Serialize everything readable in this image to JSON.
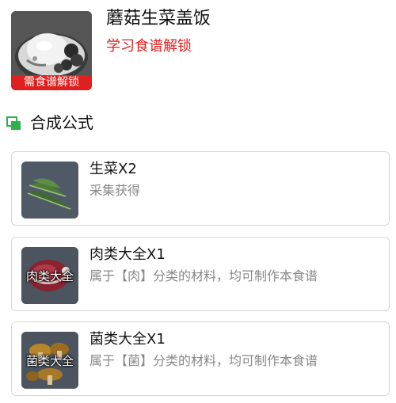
{
  "recipe": {
    "title": "蘑菇生菜盖饭",
    "unlock_hint": "学习食谱解锁",
    "locked_tag": "需食谱解锁",
    "image_icon": "rice-bowl-dish-icon"
  },
  "section": {
    "title": "合成公式",
    "icon": "stacked-squares-icon",
    "accent_color": "#2bb24c"
  },
  "ingredients": [
    {
      "name": "生菜X2",
      "desc": "采集获得",
      "thumb_label": "",
      "icon": "lettuce-icon"
    },
    {
      "name": "肉类大全X1",
      "desc": "属于【肉】分类的材料，均可制作本食谱",
      "thumb_label": "肉类大全",
      "icon": "meat-icon"
    },
    {
      "name": "菌类大全X1",
      "desc": "属于【菌】分类的材料，均可制作本食谱",
      "thumb_label": "菌类大全",
      "icon": "mushroom-icon"
    }
  ],
  "colors": {
    "lock_red": "#e0201e",
    "text_primary": "#111111",
    "text_secondary": "#888888",
    "card_border": "#d6d6d6"
  }
}
